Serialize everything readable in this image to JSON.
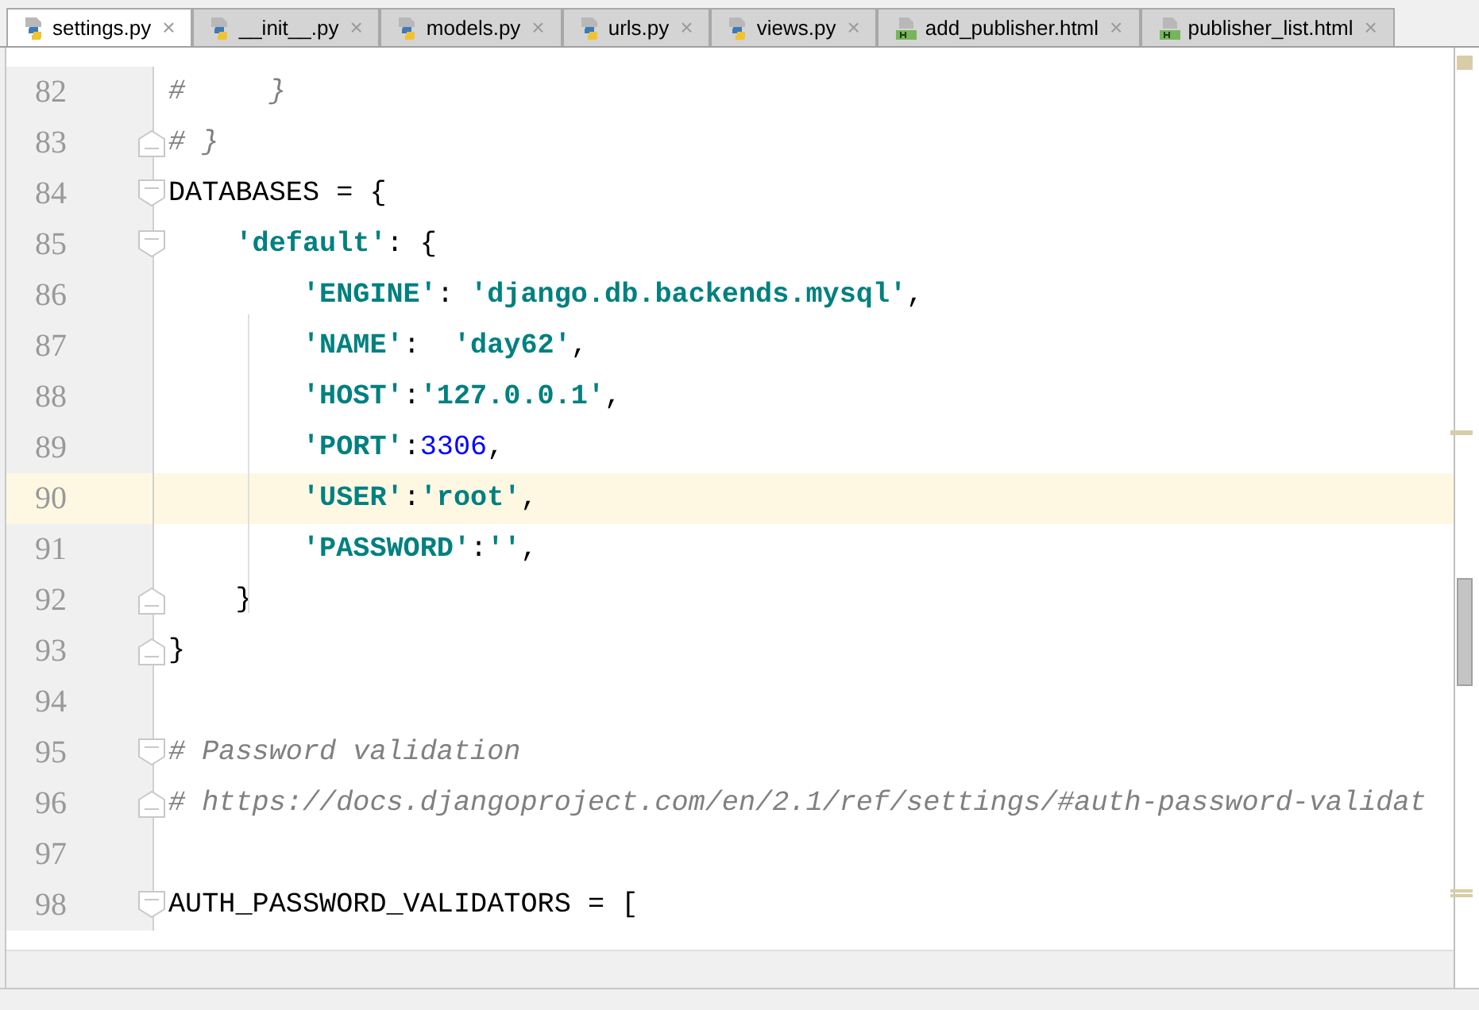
{
  "tabs": [
    {
      "label": "settings.py",
      "kind": "python",
      "selected": true
    },
    {
      "label": "__init__.py",
      "kind": "python",
      "selected": false
    },
    {
      "label": "models.py",
      "kind": "python",
      "selected": false
    },
    {
      "label": "urls.py",
      "kind": "python",
      "selected": false
    },
    {
      "label": "views.py",
      "kind": "python",
      "selected": false
    },
    {
      "label": "add_publisher.html",
      "kind": "html",
      "selected": false
    },
    {
      "label": "publisher_list.html",
      "kind": "html",
      "selected": false
    }
  ],
  "close_glyph": "×",
  "lines": [
    {
      "number": "82",
      "kind": "plain",
      "current": false,
      "segments": [
        {
          "kind": "comment",
          "text": "#     }"
        }
      ]
    },
    {
      "number": "83",
      "kind": "fold_end",
      "current": false,
      "segments": [
        {
          "kind": "comment",
          "text": "# }"
        }
      ]
    },
    {
      "number": "84",
      "kind": "fold_start",
      "current": false,
      "segments": [
        {
          "kind": "plain",
          "text": "DATABASES = "
        },
        {
          "kind": "brace",
          "text": "{"
        }
      ]
    },
    {
      "number": "85",
      "kind": "fold_start",
      "current": false,
      "segments": [
        {
          "kind": "string",
          "text": "    'default'"
        },
        {
          "kind": "plain",
          "text": ": "
        },
        {
          "kind": "brace",
          "text": "{"
        }
      ]
    },
    {
      "number": "86",
      "kind": "plain",
      "current": false,
      "segments": [
        {
          "kind": "string",
          "text": "        'ENGINE'"
        },
        {
          "kind": "plain",
          "text": ": "
        },
        {
          "kind": "string",
          "text": "'django.db.backends.mysql'"
        },
        {
          "kind": "plain",
          "text": ","
        }
      ]
    },
    {
      "number": "87",
      "kind": "plain",
      "current": false,
      "segments": [
        {
          "kind": "string",
          "text": "        'NAME'"
        },
        {
          "kind": "plain",
          "text": ":  "
        },
        {
          "kind": "string",
          "text": "'day62'"
        },
        {
          "kind": "plain",
          "text": ","
        }
      ]
    },
    {
      "number": "88",
      "kind": "plain",
      "current": false,
      "segments": [
        {
          "kind": "string",
          "text": "        'HOST'"
        },
        {
          "kind": "plain",
          "text": ":"
        },
        {
          "kind": "string",
          "text": "'127.0.0.1'"
        },
        {
          "kind": "plain",
          "text": ","
        }
      ]
    },
    {
      "number": "89",
      "kind": "plain",
      "current": false,
      "segments": [
        {
          "kind": "string",
          "text": "        'PORT'"
        },
        {
          "kind": "plain",
          "text": ":"
        },
        {
          "kind": "number",
          "text": "3306"
        },
        {
          "kind": "plain",
          "text": ","
        }
      ]
    },
    {
      "number": "90",
      "kind": "plain",
      "current": true,
      "segments": [
        {
          "kind": "string",
          "text": "        'USER'"
        },
        {
          "kind": "plain",
          "text": ":"
        },
        {
          "kind": "string",
          "text": "'root'"
        },
        {
          "kind": "plain",
          "text": ","
        }
      ]
    },
    {
      "number": "91",
      "kind": "plain",
      "current": false,
      "segments": [
        {
          "kind": "string",
          "text": "        'PASSWORD'"
        },
        {
          "kind": "plain",
          "text": ":"
        },
        {
          "kind": "string",
          "text": "''"
        },
        {
          "kind": "plain",
          "text": ","
        }
      ]
    },
    {
      "number": "92",
      "kind": "fold_end",
      "current": false,
      "segments": [
        {
          "kind": "brace",
          "text": "    }"
        }
      ]
    },
    {
      "number": "93",
      "kind": "fold_end",
      "current": false,
      "segments": [
        {
          "kind": "brace",
          "text": "}"
        }
      ]
    },
    {
      "number": "94",
      "kind": "plain",
      "current": false
    },
    {
      "number": "95",
      "kind": "fold_start",
      "current": false,
      "segments": [
        {
          "kind": "comment",
          "text": "# Password validation"
        }
      ]
    },
    {
      "number": "96",
      "kind": "fold_end",
      "current": false,
      "segments": [
        {
          "kind": "comment",
          "text": "# https://docs.djangoproject.com/en/2.1/ref/settings/#auth-password-validat"
        }
      ]
    },
    {
      "number": "97",
      "kind": "plain",
      "current": false
    },
    {
      "number": "98",
      "kind": "fold_start",
      "current": false,
      "segments": [
        {
          "kind": "plain",
          "text": "AUTH_PASSWORD_VALIDATORS = ["
        }
      ]
    }
  ]
}
